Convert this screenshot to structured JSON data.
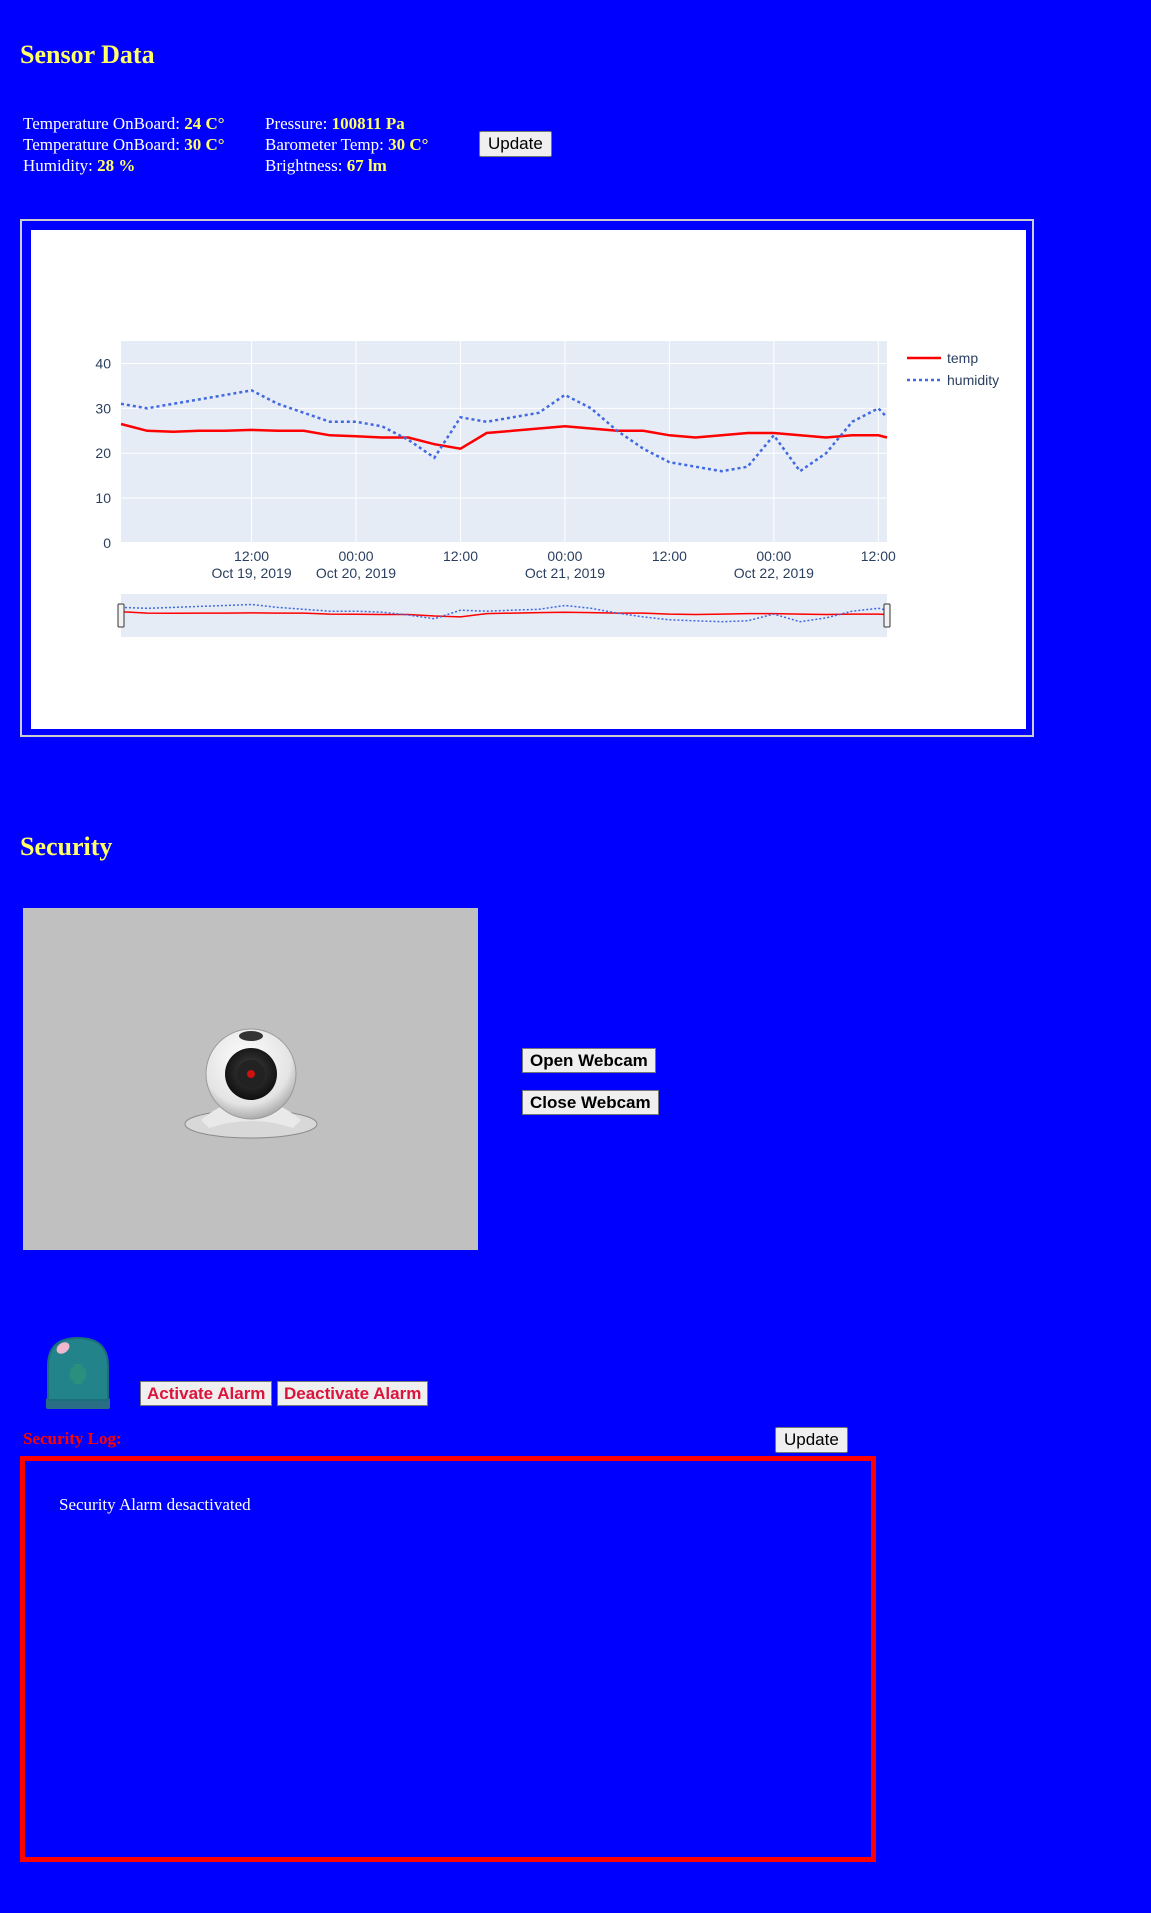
{
  "sensor": {
    "title": "Sensor Data",
    "readings": [
      {
        "label": "Temperature OnBoard: ",
        "value": "24 C°"
      },
      {
        "label": "Temperature OnBoard: ",
        "value": "30 C°"
      },
      {
        "label": "Humidity: ",
        "value": "28 %"
      },
      {
        "label": "Pressure: ",
        "value": "100811 Pa"
      },
      {
        "label": "Barometer Temp: ",
        "value": "30 C°"
      },
      {
        "label": "Brightness: ",
        "value": "67 lm"
      }
    ],
    "update_label": "Update"
  },
  "chart_data": {
    "type": "line",
    "title": "",
    "xlabel": "",
    "ylabel": "",
    "ylim": [
      0,
      45
    ],
    "yticks": [
      0,
      10,
      20,
      30,
      40
    ],
    "xlim": [
      "2019-10-18 21:00",
      "2019-10-22 13:00"
    ],
    "xticks": [
      {
        "x": "2019-10-19 12:00",
        "line1": "12:00",
        "line2": "Oct 19, 2019"
      },
      {
        "x": "2019-10-20 00:00",
        "line1": "00:00",
        "line2": "Oct 20, 2019"
      },
      {
        "x": "2019-10-20 12:00",
        "line1": "12:00",
        "line2": ""
      },
      {
        "x": "2019-10-21 00:00",
        "line1": "00:00",
        "line2": "Oct 21, 2019"
      },
      {
        "x": "2019-10-21 12:00",
        "line1": "12:00",
        "line2": ""
      },
      {
        "x": "2019-10-22 00:00",
        "line1": "00:00",
        "line2": "Oct 22, 2019"
      },
      {
        "x": "2019-10-22 12:00",
        "line1": "12:00",
        "line2": ""
      }
    ],
    "x": [
      "2019-10-18 21:00",
      "2019-10-19 00:00",
      "2019-10-19 03:00",
      "2019-10-19 06:00",
      "2019-10-19 09:00",
      "2019-10-19 12:00",
      "2019-10-19 15:00",
      "2019-10-19 18:00",
      "2019-10-19 21:00",
      "2019-10-20 00:00",
      "2019-10-20 03:00",
      "2019-10-20 06:00",
      "2019-10-20 09:00",
      "2019-10-20 12:00",
      "2019-10-20 15:00",
      "2019-10-20 18:00",
      "2019-10-20 21:00",
      "2019-10-21 00:00",
      "2019-10-21 03:00",
      "2019-10-21 06:00",
      "2019-10-21 09:00",
      "2019-10-21 12:00",
      "2019-10-21 15:00",
      "2019-10-21 18:00",
      "2019-10-21 21:00",
      "2019-10-22 00:00",
      "2019-10-22 03:00",
      "2019-10-22 06:00",
      "2019-10-22 09:00",
      "2019-10-22 12:00",
      "2019-10-22 13:00"
    ],
    "series": [
      {
        "name": "temp",
        "color": "#ff0000",
        "dash": "solid",
        "values": [
          26.5,
          25,
          24.8,
          25,
          25,
          25.2,
          25,
          25,
          24,
          23.8,
          23.5,
          23.5,
          22,
          21,
          24.5,
          25,
          25.5,
          26,
          25.5,
          25,
          25,
          24,
          23.5,
          24,
          24.5,
          24.5,
          24,
          23.5,
          24,
          24,
          23.5
        ]
      },
      {
        "name": "humidity",
        "color": "#4169e1",
        "dash": "dot",
        "values": [
          31,
          30,
          31,
          32,
          33,
          34,
          31,
          29,
          27,
          27,
          26,
          23,
          19,
          28,
          27,
          28,
          29,
          33,
          30,
          25,
          21,
          18,
          17,
          16,
          17,
          24,
          16,
          20,
          27,
          30,
          28
        ]
      }
    ],
    "legend_position": "top-right"
  },
  "security": {
    "title": "Security",
    "open_webcam_label": "Open Webcam",
    "close_webcam_label": "Close Webcam",
    "activate_alarm_label": "Activate Alarm",
    "deactivate_alarm_label": "Deactivate Alarm",
    "log_label": "Security Log:",
    "log_update_label": "Update",
    "log_entries": [
      "Security Alarm desactivated"
    ]
  },
  "icons": {
    "webcam": "webcam-icon",
    "alarm": "siren-icon"
  }
}
